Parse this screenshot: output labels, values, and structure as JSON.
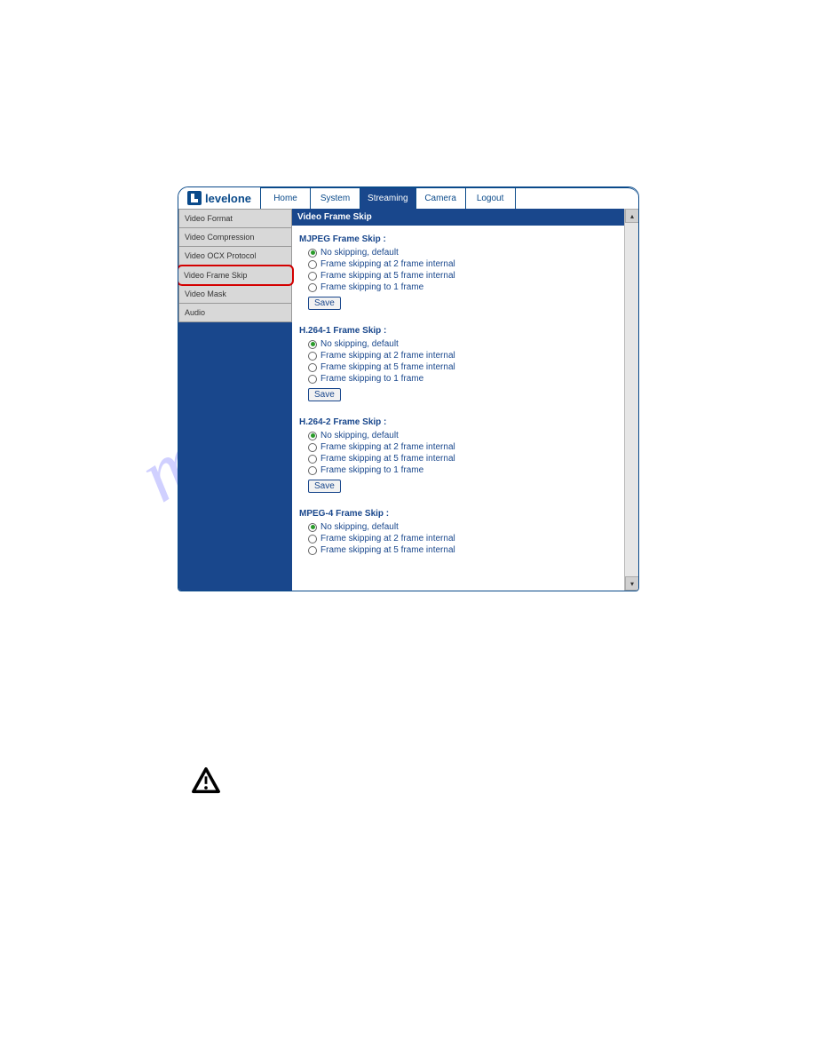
{
  "logo": {
    "text": "levelone"
  },
  "tabs": [
    {
      "label": "Home",
      "active": false
    },
    {
      "label": "System",
      "active": false
    },
    {
      "label": "Streaming",
      "active": true
    },
    {
      "label": "Camera",
      "active": false
    },
    {
      "label": "Logout",
      "active": false
    }
  ],
  "sidebar": {
    "items": [
      {
        "label": "Video Format"
      },
      {
        "label": "Video Compression"
      },
      {
        "label": "Video OCX Protocol"
      },
      {
        "label": "Video Frame Skip",
        "highlight": true
      },
      {
        "label": "Video Mask"
      },
      {
        "label": "Audio"
      }
    ]
  },
  "panel": {
    "title": "Video Frame Skip",
    "sections": [
      {
        "head": "MJPEG Frame Skip :",
        "options": [
          {
            "label": "No skipping, default",
            "checked": true
          },
          {
            "label": "Frame skipping at 2 frame internal",
            "checked": false
          },
          {
            "label": "Frame skipping at 5 frame internal",
            "checked": false
          },
          {
            "label": "Frame skipping to 1 frame",
            "checked": false
          }
        ],
        "save": "Save"
      },
      {
        "head": "H.264-1 Frame Skip :",
        "options": [
          {
            "label": "No skipping, default",
            "checked": true
          },
          {
            "label": "Frame skipping at 2 frame internal",
            "checked": false
          },
          {
            "label": "Frame skipping at 5 frame internal",
            "checked": false
          },
          {
            "label": "Frame skipping to 1 frame",
            "checked": false
          }
        ],
        "save": "Save"
      },
      {
        "head": "H.264-2 Frame Skip :",
        "options": [
          {
            "label": "No skipping, default",
            "checked": true
          },
          {
            "label": "Frame skipping at 2 frame internal",
            "checked": false
          },
          {
            "label": "Frame skipping at 5 frame internal",
            "checked": false
          },
          {
            "label": "Frame skipping to 1 frame",
            "checked": false
          }
        ],
        "save": "Save"
      },
      {
        "head": "MPEG-4 Frame Skip :",
        "options": [
          {
            "label": "No skipping, default",
            "checked": true
          },
          {
            "label": "Frame skipping at 2 frame internal",
            "checked": false
          },
          {
            "label": "Frame skipping at 5 frame internal",
            "checked": false
          }
        ],
        "save": null
      }
    ]
  },
  "scrollbar": {
    "up": "▴",
    "down": "▾"
  },
  "watermark": "manualshive.com"
}
